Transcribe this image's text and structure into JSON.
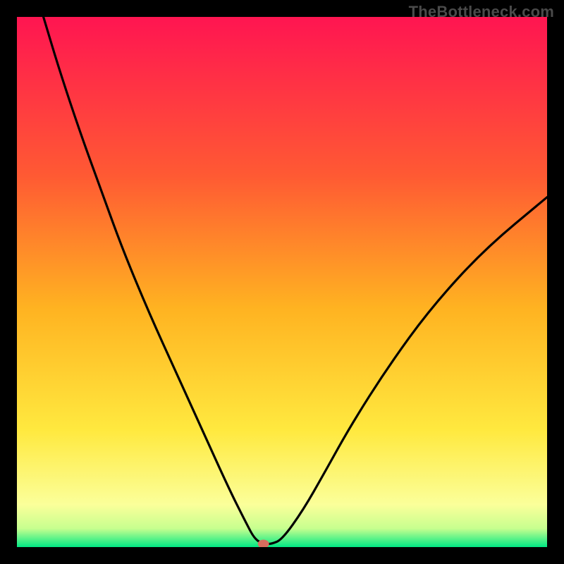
{
  "watermark": "TheBottleneck.com",
  "chart_data": {
    "type": "line",
    "title": "",
    "xlabel": "",
    "ylabel": "",
    "xlim": [
      0,
      100
    ],
    "ylim": [
      0,
      100
    ],
    "grid": false,
    "legend": false,
    "annotations": [],
    "gradient_stops": [
      {
        "offset": 0.0,
        "color": "#ff1551"
      },
      {
        "offset": 0.3,
        "color": "#ff5a33"
      },
      {
        "offset": 0.55,
        "color": "#ffb321"
      },
      {
        "offset": 0.78,
        "color": "#ffe93f"
      },
      {
        "offset": 0.92,
        "color": "#fbff9a"
      },
      {
        "offset": 0.965,
        "color": "#c7ff8f"
      },
      {
        "offset": 1.0,
        "color": "#00e884"
      }
    ],
    "marker": {
      "x": 46.5,
      "y": 0.6,
      "color": "#d96e5f"
    },
    "series": [
      {
        "name": "bottleneck-curve",
        "x": [
          5.0,
          8.0,
          12.0,
          16.0,
          20.0,
          25.0,
          30.0,
          35.0,
          40.0,
          43.0,
          45.0,
          47.0,
          48.0,
          50.0,
          54.0,
          58.0,
          63.0,
          70.0,
          78.0,
          88.0,
          100.0
        ],
        "y": [
          100.0,
          90.0,
          78.0,
          67.0,
          56.0,
          44.0,
          33.0,
          22.0,
          11.0,
          5.0,
          1.2,
          0.6,
          0.6,
          1.4,
          7.0,
          14.0,
          23.0,
          34.0,
          45.0,
          56.0,
          66.0
        ]
      }
    ]
  }
}
